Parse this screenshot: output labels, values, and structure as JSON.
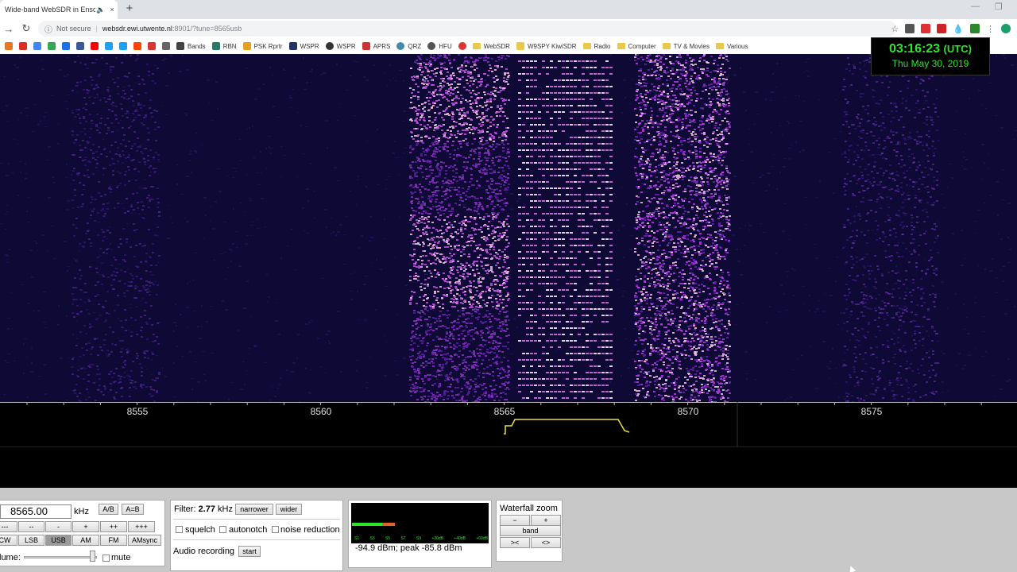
{
  "browser": {
    "tab_title": "Wide-band WebSDR in Ensc",
    "security_label": "Not secure",
    "url_host": "websdr.ewi.utwente.nl",
    "url_path": ":8901/?tune=8565usb",
    "bookmarks": [
      "Bands",
      "RBN",
      "PSK Rprtr",
      "WSPR",
      "WSPR",
      "APRS",
      "QRZ",
      "HFU",
      "WebSDR",
      "W9SPY KiwiSDR",
      "Radio",
      "Computer",
      "TV & Movies",
      "Various"
    ]
  },
  "clock": {
    "time": "03:16:23",
    "tz": "(UTC)",
    "date": "Thu May 30, 2019"
  },
  "scale": {
    "ticks": [
      "8555",
      "8560",
      "8565",
      "8570",
      "8575"
    ]
  },
  "tuning": {
    "frequency": "8565.00",
    "unit": "kHz",
    "ab_label": "A/B",
    "aeqb_label": "A=B",
    "step_buttons": [
      "---",
      "--",
      "-",
      "+",
      "++",
      "+++"
    ],
    "modes": [
      "CW",
      "LSB",
      "USB",
      "AM",
      "FM",
      "AMsync"
    ],
    "selected_mode": "USB",
    "volume_label": "lume:",
    "mute_label": "mute"
  },
  "filter": {
    "label": "Filter:",
    "width": "2.77",
    "unit": "kHz",
    "narrower": "narrower",
    "wider": "wider",
    "squelch": "squelch",
    "autonotch": "autonotch",
    "noise_reduction": "noise reduction",
    "audio_recording": "Audio recording",
    "start": "start"
  },
  "smeter": {
    "scale": [
      "S1",
      "S3",
      "S5",
      "S7",
      "S9",
      "+20dB",
      "+40dB",
      "+60dB"
    ],
    "reading": "-94.9 dBm; peak  -85.8 dBm"
  },
  "zoom": {
    "title": "Waterfall zoom",
    "minus": "−",
    "plus": "+",
    "band": "band",
    "narrow": "><",
    "wide": "<>"
  }
}
